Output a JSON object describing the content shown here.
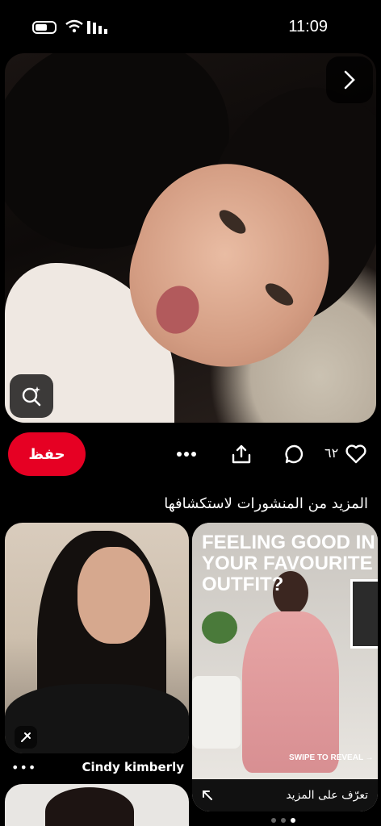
{
  "status_bar": {
    "time": "11:09"
  },
  "pin": {
    "save_label": "حفظ",
    "like_count": "٦٢"
  },
  "section": {
    "title": "المزيد من المنشورات لاستكشافها"
  },
  "cards": [
    {
      "author": "Cindy kimberly",
      "more_label": "•••"
    },
    {
      "promo_text": "FEELING GOOD IN YOUR FAVOURITE OUTFIT?",
      "swipe_text": "SWIPE TO REVEAL →",
      "cta_label": "تعرّف على المزيد"
    }
  ],
  "colors": {
    "save": "#e60023",
    "background": "#000000"
  }
}
